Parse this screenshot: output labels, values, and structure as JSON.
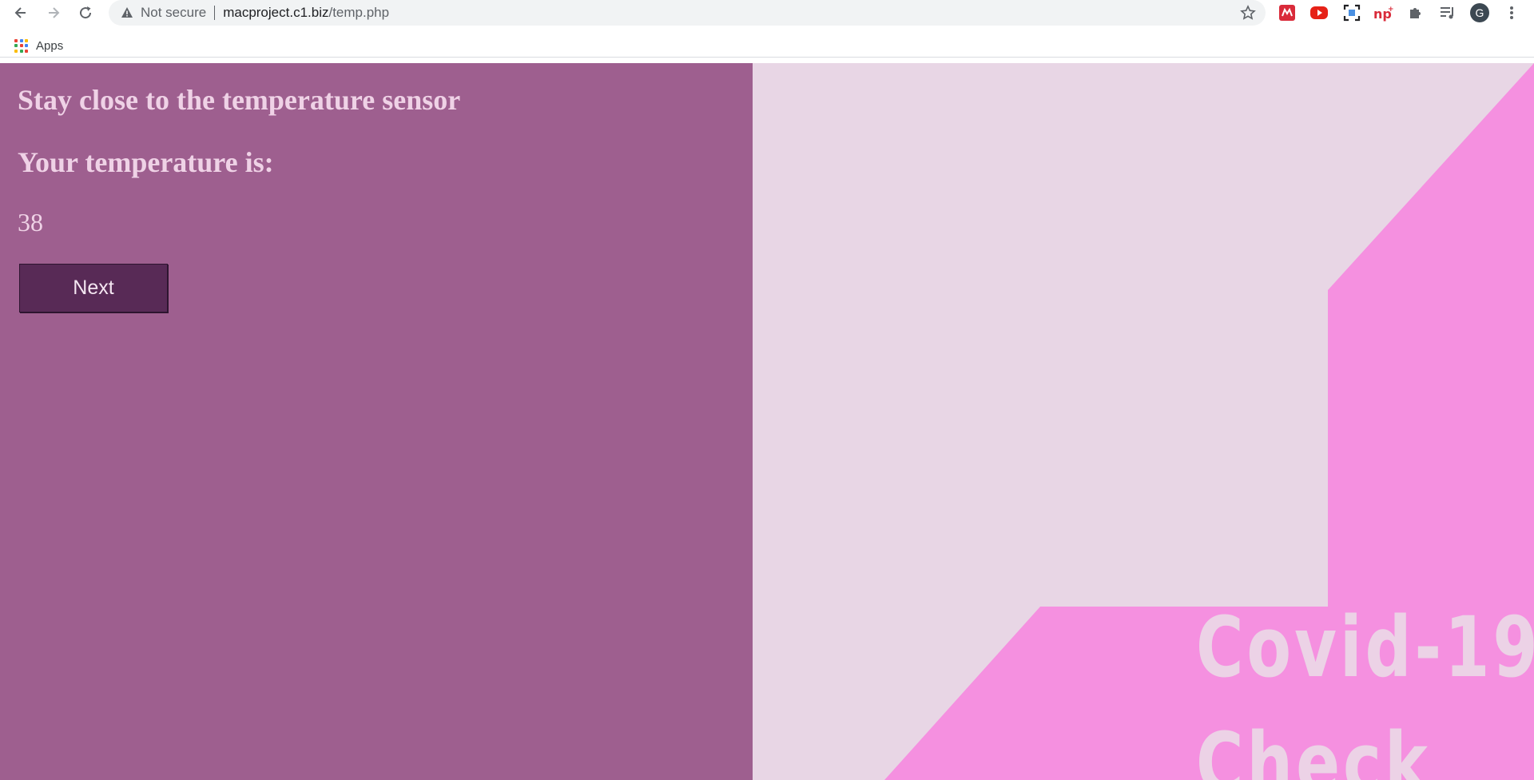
{
  "browser": {
    "security_label": "Not secure",
    "url_host": "macproject.c1.biz",
    "url_path": "/temp.php",
    "profile_initial": "G",
    "bookmarks": {
      "apps_label": "Apps"
    }
  },
  "page": {
    "heading_1": "Stay close to the temperature sensor",
    "heading_2": "Your temperature is:",
    "temperature_value": "38",
    "next_button_label": "Next",
    "banner_line_1": "Covid-19",
    "banner_line_2": "Check"
  },
  "colors": {
    "left_pane": "#9e5f8f",
    "heading_text": "#efd2e6",
    "button_bg": "#582a56",
    "right_light": "#e8d6e5",
    "right_accent": "#f590e0"
  }
}
